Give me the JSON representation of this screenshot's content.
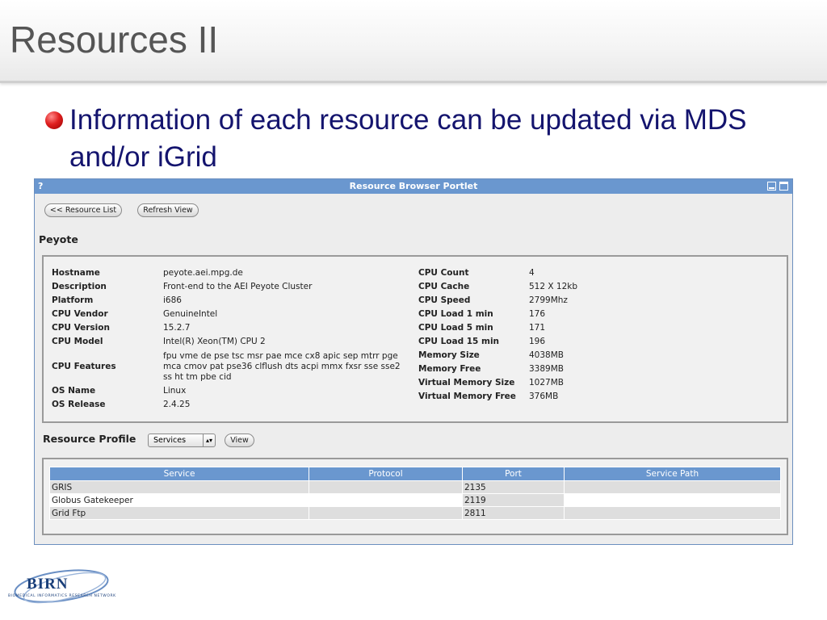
{
  "slide": {
    "title": "Resources II",
    "bullet": "Information of each resource can be  updated via MDS and/or iGrid"
  },
  "portlet": {
    "help_glyph": "?",
    "title": "Resource Browser Portlet",
    "buttons": {
      "resource_list": "<< Resource List",
      "refresh_view": "Refresh View"
    },
    "resource_name": "Peyote",
    "info_left": [
      {
        "label": "Hostname",
        "value": "peyote.aei.mpg.de"
      },
      {
        "label": "Description",
        "value": "Front-end to the AEI Peyote Cluster"
      },
      {
        "label": "Platform",
        "value": "i686"
      },
      {
        "label": "CPU Vendor",
        "value": "GenuineIntel"
      },
      {
        "label": "CPU Version",
        "value": "15.2.7"
      },
      {
        "label": "CPU Model",
        "value": "Intel(R) Xeon(TM) CPU 2"
      },
      {
        "label": "CPU Features",
        "value_lines": [
          "fpu vme de pse tsc msr pae mce cx8 apic sep mtrr pge",
          "mca cmov pat pse36 clflush dts acpi mmx fxsr sse sse2",
          "ss ht tm pbe cid"
        ]
      },
      {
        "label": "OS Name",
        "value": "Linux"
      },
      {
        "label": "OS Release",
        "value": "2.4.25"
      }
    ],
    "info_right": [
      {
        "label": "CPU Count",
        "value": "4"
      },
      {
        "label": "CPU Cache",
        "value": "512 X 12kb"
      },
      {
        "label": "CPU Speed",
        "value": "2799Mhz"
      },
      {
        "label": "CPU Load 1 min",
        "value": "176"
      },
      {
        "label": "CPU Load 5 min",
        "value": "171"
      },
      {
        "label": "CPU Load 15 min",
        "value": "196"
      },
      {
        "label": "Memory Size",
        "value": "4038MB"
      },
      {
        "label": "Memory Free",
        "value": "3389MB"
      },
      {
        "label": "Virtual Memory Size",
        "value": "1027MB"
      },
      {
        "label": "Virtual Memory Free",
        "value": "376MB"
      }
    ],
    "profile": {
      "label": "Resource Profile",
      "selected": "Services",
      "view_button": "View"
    },
    "table": {
      "headers": [
        "Service",
        "Protocol",
        "Port",
        "Service Path"
      ],
      "rows": [
        [
          "GRIS",
          "",
          "2135",
          ""
        ],
        [
          "Globus Gatekeeper",
          "",
          "2119",
          ""
        ],
        [
          "Grid Ftp",
          "",
          "2811",
          ""
        ]
      ]
    }
  },
  "logo": {
    "word": "BIRN",
    "subtitle": "BIOMEDICAL INFORMATICS RESEARCH NETWORK"
  }
}
